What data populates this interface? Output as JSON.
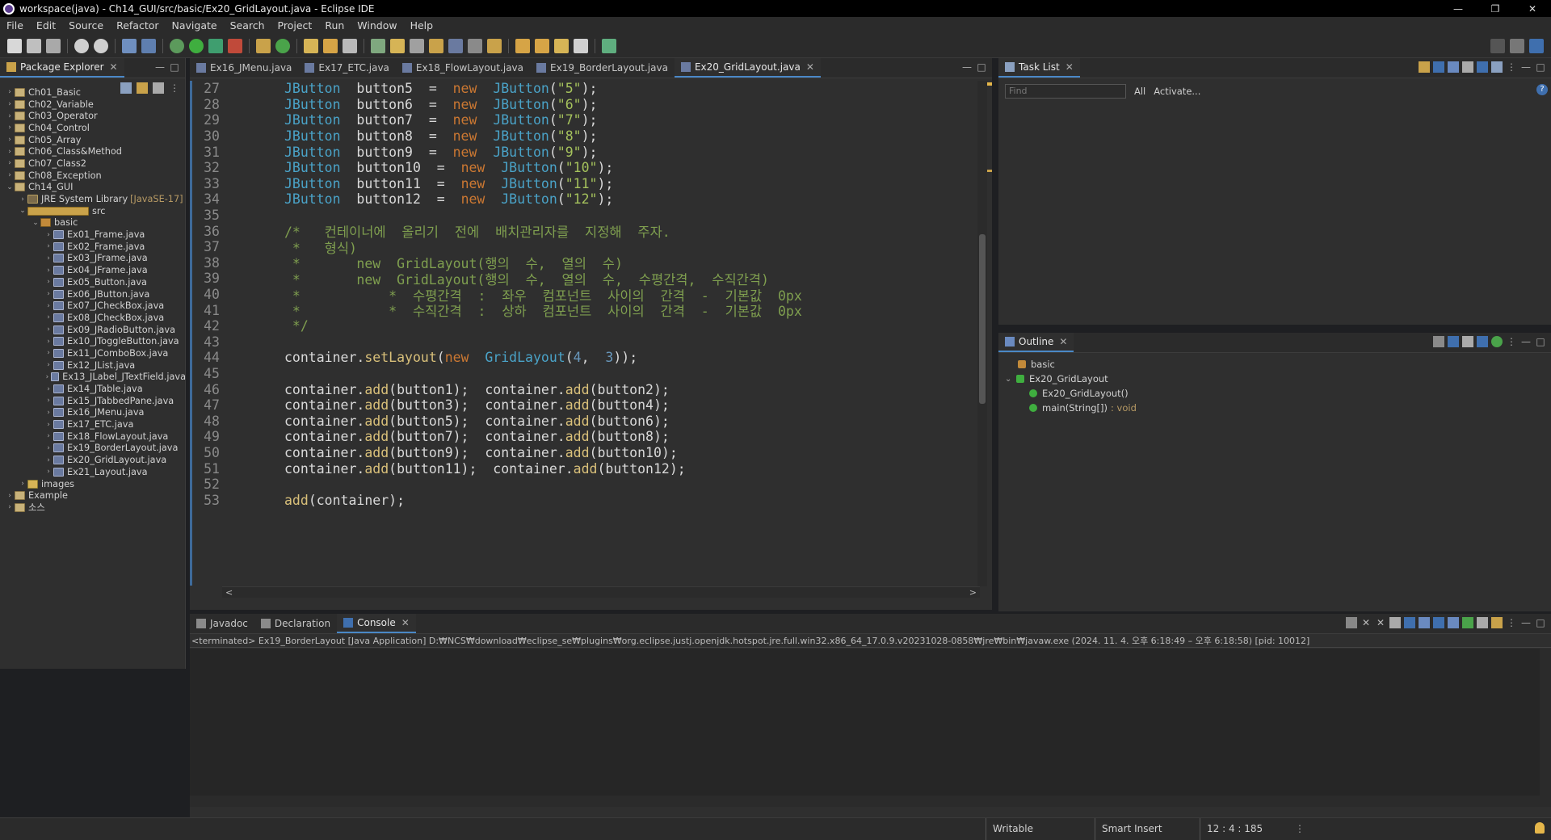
{
  "window": {
    "title": "workspace(java) - Ch14_GUI/src/basic/Ex20_GridLayout.java - Eclipse IDE",
    "minimize": "—",
    "maximize": "❐",
    "close": "✕"
  },
  "menu": [
    "File",
    "Edit",
    "Source",
    "Refactor",
    "Navigate",
    "Search",
    "Project",
    "Run",
    "Window",
    "Help"
  ],
  "package_explorer": {
    "tab_label": "Package Explorer",
    "items": [
      {
        "label": "Ch01_Basic",
        "type": "proj",
        "depth": 0,
        "arrow": "›"
      },
      {
        "label": "Ch02_Variable",
        "type": "proj",
        "depth": 0,
        "arrow": "›"
      },
      {
        "label": "Ch03_Operator",
        "type": "proj",
        "depth": 0,
        "arrow": "›"
      },
      {
        "label": "Ch04_Control",
        "type": "proj",
        "depth": 0,
        "arrow": "›"
      },
      {
        "label": "Ch05_Array",
        "type": "proj",
        "depth": 0,
        "arrow": "›"
      },
      {
        "label": "Ch06_Class&Method",
        "type": "proj",
        "depth": 0,
        "arrow": "›"
      },
      {
        "label": "Ch07_Class2",
        "type": "proj",
        "depth": 0,
        "arrow": "›"
      },
      {
        "label": "Ch08_Exception",
        "type": "proj",
        "depth": 0,
        "arrow": "›"
      },
      {
        "label": "Ch14_GUI",
        "type": "proj",
        "depth": 0,
        "arrow": "⌄"
      },
      {
        "label": "JRE System Library",
        "suffix": "[JavaSE-17]",
        "type": "lib",
        "depth": 1,
        "arrow": "›"
      },
      {
        "label": "src",
        "type": "src",
        "depth": 1,
        "arrow": "⌄"
      },
      {
        "label": "basic",
        "type": "pkg",
        "depth": 2,
        "arrow": "⌄"
      },
      {
        "label": "Ex01_Frame.java",
        "type": "java",
        "depth": 3,
        "arrow": "›"
      },
      {
        "label": "Ex02_Frame.java",
        "type": "java",
        "depth": 3,
        "arrow": "›"
      },
      {
        "label": "Ex03_JFrame.java",
        "type": "java",
        "depth": 3,
        "arrow": "›"
      },
      {
        "label": "Ex04_JFrame.java",
        "type": "java",
        "depth": 3,
        "arrow": "›"
      },
      {
        "label": "Ex05_Button.java",
        "type": "java",
        "depth": 3,
        "arrow": "›"
      },
      {
        "label": "Ex06_JButton.java",
        "type": "java",
        "depth": 3,
        "arrow": "›"
      },
      {
        "label": "Ex07_JCheckBox.java",
        "type": "java",
        "depth": 3,
        "arrow": "›"
      },
      {
        "label": "Ex08_JCheckBox.java",
        "type": "java",
        "depth": 3,
        "arrow": "›"
      },
      {
        "label": "Ex09_JRadioButton.java",
        "type": "java",
        "depth": 3,
        "arrow": "›"
      },
      {
        "label": "Ex10_JToggleButton.java",
        "type": "java",
        "depth": 3,
        "arrow": "›"
      },
      {
        "label": "Ex11_JComboBox.java",
        "type": "java",
        "depth": 3,
        "arrow": "›"
      },
      {
        "label": "Ex12_JList.java",
        "type": "java",
        "depth": 3,
        "arrow": "›"
      },
      {
        "label": "Ex13_JLabel_JTextField.java",
        "type": "java",
        "depth": 3,
        "arrow": "›"
      },
      {
        "label": "Ex14_JTable.java",
        "type": "java",
        "depth": 3,
        "arrow": "›"
      },
      {
        "label": "Ex15_JTabbedPane.java",
        "type": "java",
        "depth": 3,
        "arrow": "›"
      },
      {
        "label": "Ex16_JMenu.java",
        "type": "java",
        "depth": 3,
        "arrow": "›"
      },
      {
        "label": "Ex17_ETC.java",
        "type": "java",
        "depth": 3,
        "arrow": "›"
      },
      {
        "label": "Ex18_FlowLayout.java",
        "type": "java",
        "depth": 3,
        "arrow": "›"
      },
      {
        "label": "Ex19_BorderLayout.java",
        "type": "java",
        "depth": 3,
        "arrow": "›"
      },
      {
        "label": "Ex20_GridLayout.java",
        "type": "java",
        "depth": 3,
        "arrow": "›"
      },
      {
        "label": "Ex21_Layout.java",
        "type": "java",
        "depth": 3,
        "arrow": "›"
      },
      {
        "label": "images",
        "type": "folder",
        "depth": 1,
        "arrow": "›"
      },
      {
        "label": "Example",
        "type": "proj",
        "depth": 0,
        "arrow": "›"
      },
      {
        "label": "소스",
        "type": "proj",
        "depth": 0,
        "arrow": "›"
      }
    ]
  },
  "editor": {
    "tabs": [
      {
        "label": "Ex16_JMenu.java",
        "active": false
      },
      {
        "label": "Ex17_ETC.java",
        "active": false
      },
      {
        "label": "Ex18_FlowLayout.java",
        "active": false
      },
      {
        "label": "Ex19_BorderLayout.java",
        "active": false
      },
      {
        "label": "Ex20_GridLayout.java",
        "active": true
      }
    ],
    "lines": [
      {
        "n": "27",
        "tokens": [
          [
            "typ",
            "JButton"
          ],
          [
            "",
            "  button5  =  "
          ],
          [
            "kw",
            "new"
          ],
          [
            "",
            "  "
          ],
          [
            "typ",
            "JButton"
          ],
          [
            "",
            "("
          ],
          [
            "str",
            "\"5\""
          ],
          [
            "",
            ");"
          ]
        ]
      },
      {
        "n": "28",
        "tokens": [
          [
            "typ",
            "JButton"
          ],
          [
            "",
            "  button6  =  "
          ],
          [
            "kw",
            "new"
          ],
          [
            "",
            "  "
          ],
          [
            "typ",
            "JButton"
          ],
          [
            "",
            "("
          ],
          [
            "str",
            "\"6\""
          ],
          [
            "",
            ");"
          ]
        ]
      },
      {
        "n": "29",
        "tokens": [
          [
            "typ",
            "JButton"
          ],
          [
            "",
            "  button7  =  "
          ],
          [
            "kw",
            "new"
          ],
          [
            "",
            "  "
          ],
          [
            "typ",
            "JButton"
          ],
          [
            "",
            "("
          ],
          [
            "str",
            "\"7\""
          ],
          [
            "",
            ");"
          ]
        ]
      },
      {
        "n": "30",
        "tokens": [
          [
            "typ",
            "JButton"
          ],
          [
            "",
            "  button8  =  "
          ],
          [
            "kw",
            "new"
          ],
          [
            "",
            "  "
          ],
          [
            "typ",
            "JButton"
          ],
          [
            "",
            "("
          ],
          [
            "str",
            "\"8\""
          ],
          [
            "",
            ");"
          ]
        ]
      },
      {
        "n": "31",
        "tokens": [
          [
            "typ",
            "JButton"
          ],
          [
            "",
            "  button9  =  "
          ],
          [
            "kw",
            "new"
          ],
          [
            "",
            "  "
          ],
          [
            "typ",
            "JButton"
          ],
          [
            "",
            "("
          ],
          [
            "str",
            "\"9\""
          ],
          [
            "",
            ");"
          ]
        ]
      },
      {
        "n": "32",
        "tokens": [
          [
            "typ",
            "JButton"
          ],
          [
            "",
            "  button10  =  "
          ],
          [
            "kw",
            "new"
          ],
          [
            "",
            "  "
          ],
          [
            "typ",
            "JButton"
          ],
          [
            "",
            "("
          ],
          [
            "str",
            "\"10\""
          ],
          [
            "",
            ");"
          ]
        ]
      },
      {
        "n": "33",
        "tokens": [
          [
            "typ",
            "JButton"
          ],
          [
            "",
            "  button11  =  "
          ],
          [
            "kw",
            "new"
          ],
          [
            "",
            "  "
          ],
          [
            "typ",
            "JButton"
          ],
          [
            "",
            "("
          ],
          [
            "str",
            "\"11\""
          ],
          [
            "",
            ");"
          ]
        ]
      },
      {
        "n": "34",
        "tokens": [
          [
            "typ",
            "JButton"
          ],
          [
            "",
            "  button12  =  "
          ],
          [
            "kw",
            "new"
          ],
          [
            "",
            "  "
          ],
          [
            "typ",
            "JButton"
          ],
          [
            "",
            "("
          ],
          [
            "str",
            "\"12\""
          ],
          [
            "",
            ");"
          ]
        ]
      },
      {
        "n": "35",
        "tokens": []
      },
      {
        "n": "36",
        "tokens": [
          [
            "cmt",
            "/*   컨테이너에  올리기  전에  배치관리자를  지정해  주자."
          ]
        ]
      },
      {
        "n": "37",
        "tokens": [
          [
            "cmt",
            " *   형식)"
          ]
        ]
      },
      {
        "n": "38",
        "tokens": [
          [
            "cmt",
            " *       new  GridLayout(행의  수,  열의  수)"
          ]
        ]
      },
      {
        "n": "39",
        "tokens": [
          [
            "cmt",
            " *       new  GridLayout(행의  수,  열의  수,  수평간격,  수직간격)"
          ]
        ]
      },
      {
        "n": "40",
        "tokens": [
          [
            "cmt",
            " *           *  수평간격  :  좌우  컴포넌트  사이의  간격  -  기본값  0px"
          ]
        ]
      },
      {
        "n": "41",
        "tokens": [
          [
            "cmt",
            " *           *  수직간격  :  상하  컴포넌트  사이의  간격  -  기본값  0px"
          ]
        ]
      },
      {
        "n": "42",
        "tokens": [
          [
            "cmt",
            " */"
          ]
        ]
      },
      {
        "n": "43",
        "tokens": []
      },
      {
        "n": "44",
        "tokens": [
          [
            "",
            "container."
          ],
          [
            "fn",
            "setLayout"
          ],
          [
            "",
            "("
          ],
          [
            "kw",
            "new"
          ],
          [
            "",
            "  "
          ],
          [
            "typ",
            "GridLayout"
          ],
          [
            "",
            "("
          ],
          [
            "num",
            "4"
          ],
          [
            "",
            ",  "
          ],
          [
            "num",
            "3"
          ],
          [
            "",
            "));"
          ]
        ]
      },
      {
        "n": "45",
        "tokens": []
      },
      {
        "n": "46",
        "tokens": [
          [
            "",
            "container."
          ],
          [
            "fn",
            "add"
          ],
          [
            "",
            "(button1);  container."
          ],
          [
            "fn",
            "add"
          ],
          [
            "",
            "(button2);"
          ]
        ]
      },
      {
        "n": "47",
        "tokens": [
          [
            "",
            "container."
          ],
          [
            "fn",
            "add"
          ],
          [
            "",
            "(button3);  container."
          ],
          [
            "fn",
            "add"
          ],
          [
            "",
            "(button4);"
          ]
        ]
      },
      {
        "n": "48",
        "tokens": [
          [
            "",
            "container."
          ],
          [
            "fn",
            "add"
          ],
          [
            "",
            "(button5);  container."
          ],
          [
            "fn",
            "add"
          ],
          [
            "",
            "(button6);"
          ]
        ]
      },
      {
        "n": "49",
        "tokens": [
          [
            "",
            "container."
          ],
          [
            "fn",
            "add"
          ],
          [
            "",
            "(button7);  container."
          ],
          [
            "fn",
            "add"
          ],
          [
            "",
            "(button8);"
          ]
        ]
      },
      {
        "n": "50",
        "tokens": [
          [
            "",
            "container."
          ],
          [
            "fn",
            "add"
          ],
          [
            "",
            "(button9);  container."
          ],
          [
            "fn",
            "add"
          ],
          [
            "",
            "(button10);"
          ]
        ]
      },
      {
        "n": "51",
        "tokens": [
          [
            "",
            "container."
          ],
          [
            "fn",
            "add"
          ],
          [
            "",
            "(button11);  container."
          ],
          [
            "fn",
            "add"
          ],
          [
            "",
            "(button12);"
          ]
        ]
      },
      {
        "n": "52",
        "tokens": []
      },
      {
        "n": "53",
        "tokens": [
          [
            "fn",
            "add"
          ],
          [
            "",
            "(container);"
          ]
        ]
      }
    ]
  },
  "task_list": {
    "tab_label": "Task List",
    "find_placeholder": "Find",
    "all_label": "All",
    "activate_label": "Activate..."
  },
  "outline": {
    "tab_label": "Outline",
    "items": [
      {
        "label": "basic",
        "suffix": "",
        "depth": 0
      },
      {
        "label": "Ex20_GridLayout",
        "suffix": "",
        "depth": 0
      },
      {
        "label": "Ex20_GridLayout()",
        "suffix": "",
        "depth": 1
      },
      {
        "label": "main(String[])",
        "suffix": ": void",
        "depth": 1
      }
    ]
  },
  "bottom_panel": {
    "tabs": [
      {
        "label": "Javadoc",
        "active": false
      },
      {
        "label": "Declaration",
        "active": false
      },
      {
        "label": "Console",
        "active": true
      }
    ],
    "console_header": "<terminated> Ex19_BorderLayout [Java Application] D:₩NCS₩download₩eclipse_se₩plugins₩org.eclipse.justj.openjdk.hotspot.jre.full.win32.x86_64_17.0.9.v20231028-0858₩jre₩bin₩javaw.exe  (2024. 11. 4. 오후 6:18:49 – 오후 6:18:58) [pid: 10012]"
  },
  "status": {
    "writable": "Writable",
    "insert_mode": "Smart Insert",
    "position": "12 : 4 : 185"
  },
  "colors": {
    "accent": "#4a88c7",
    "keyword": "#cc7832",
    "type": "#4aa3c8",
    "string": "#a5c25c",
    "comment": "#7f9f4f"
  }
}
